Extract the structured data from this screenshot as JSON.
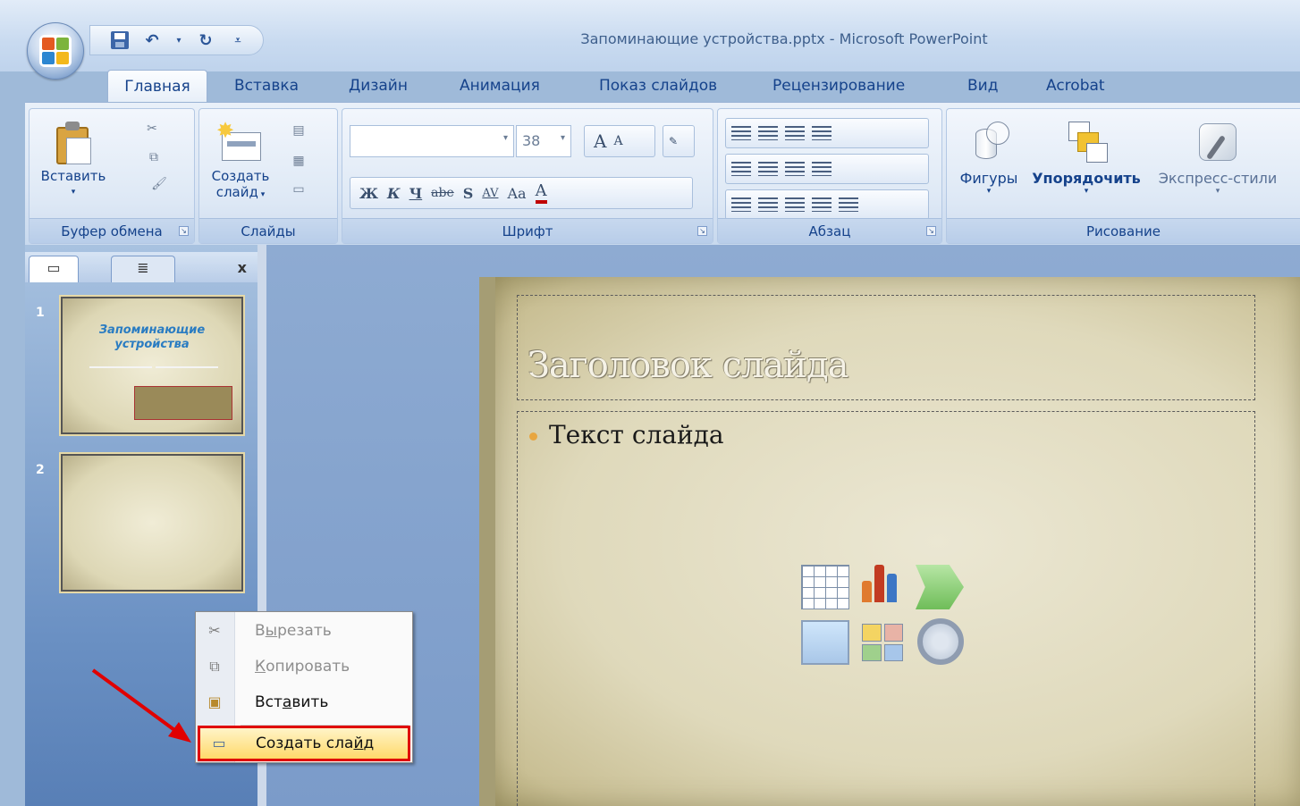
{
  "window": {
    "title": "Запоминающие устройства.pptx - Microsoft PowerPoint"
  },
  "tabs": [
    {
      "label": "Главная"
    },
    {
      "label": "Вставка"
    },
    {
      "label": "Дизайн"
    },
    {
      "label": "Анимация"
    },
    {
      "label": "Показ слайдов"
    },
    {
      "label": "Рецензирование"
    },
    {
      "label": "Вид"
    },
    {
      "label": "Acrobat"
    }
  ],
  "ribbon": {
    "clipboard": {
      "group_label": "Буфер обмена",
      "paste_label": "Вставить"
    },
    "slides": {
      "group_label": "Слайды",
      "new_slide_line1": "Создать",
      "new_slide_line2": "слайд"
    },
    "font": {
      "group_label": "Шрифт",
      "size_value": "38",
      "bold": "Ж",
      "italic": "К",
      "underline": "Ч",
      "strike": "abe",
      "shadow": "S",
      "spacing": "AV",
      "case": "Aa",
      "grow": "A",
      "shrink": "A",
      "color": "A"
    },
    "paragraph": {
      "group_label": "Абзац"
    },
    "drawing": {
      "group_label": "Рисование",
      "shapes_label": "Фигуры",
      "arrange_label": "Упорядочить",
      "quick_styles_label": "Экспресс-стили"
    }
  },
  "slides_pane": {
    "close_label": "x",
    "thumbnails": [
      {
        "number": "1",
        "title": "Запоминающие устройства"
      },
      {
        "number": "2"
      }
    ]
  },
  "slide": {
    "title_placeholder": "Заголовок слайда",
    "body_placeholder": "Текст слайда"
  },
  "context_menu": {
    "items": [
      {
        "pre": "В",
        "u": "ы",
        "post": "резать"
      },
      {
        "pre": "",
        "u": "К",
        "post": "опировать"
      },
      {
        "pre": "Вст",
        "u": "а",
        "post": "вить"
      },
      {
        "pre": "Создать сла",
        "u": "й",
        "post": "д"
      }
    ]
  },
  "colors": {
    "highlight_border": "#e00000",
    "annotation_arrow": "#e00000",
    "ribbon_text": "#15428b"
  }
}
